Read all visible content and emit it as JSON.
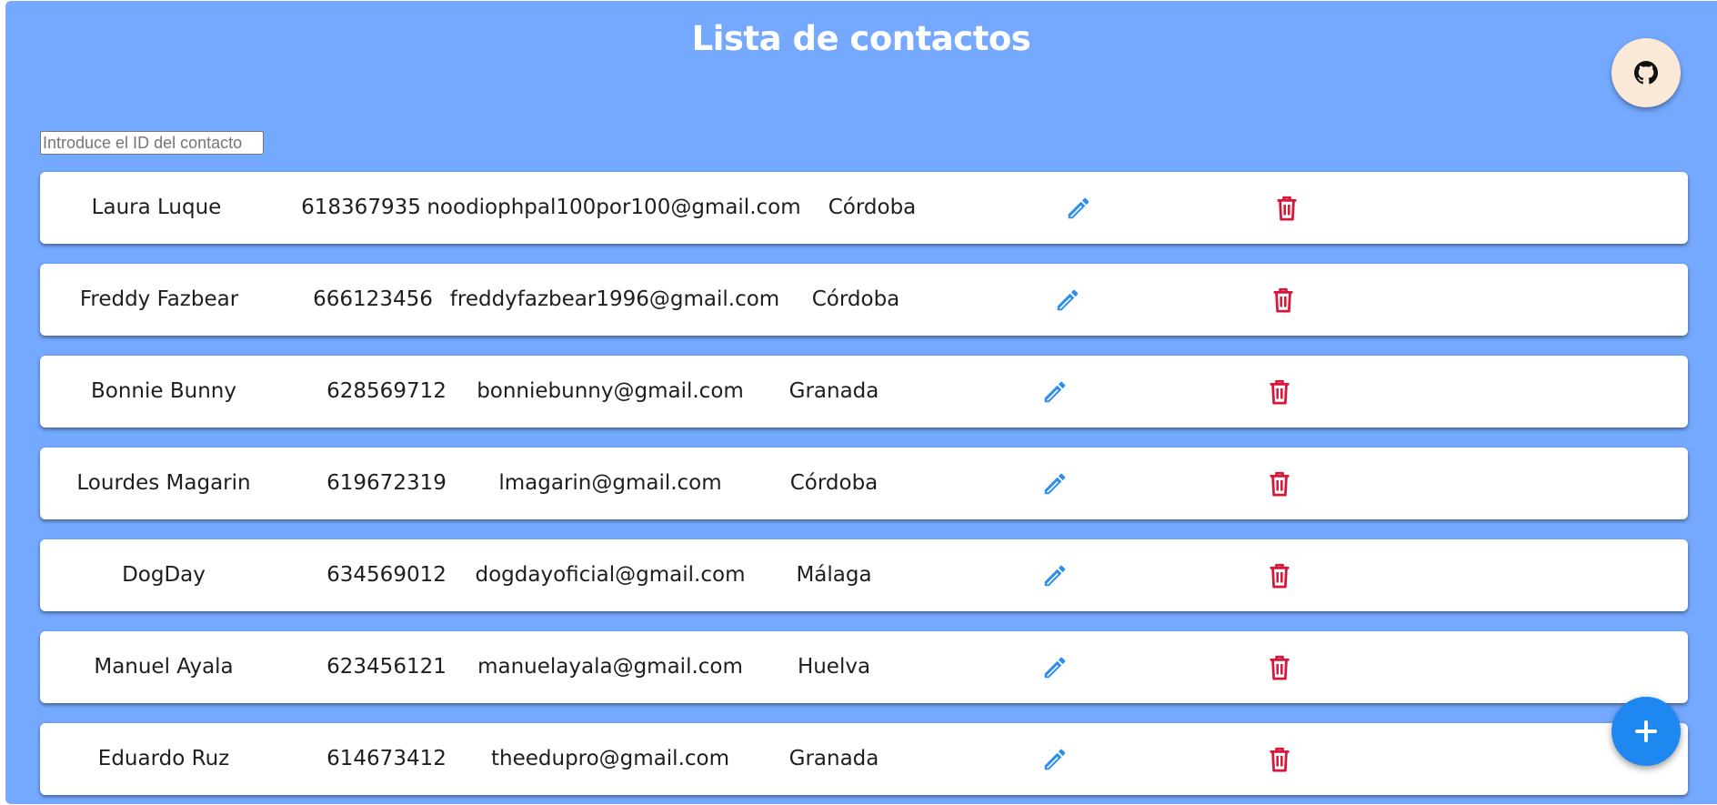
{
  "header": {
    "title": "Lista de contactos",
    "github_icon": "github-icon"
  },
  "search": {
    "placeholder": "Introduce el ID del contacto",
    "value": ""
  },
  "contacts": [
    {
      "name": "Laura Luque",
      "phone": "618367935",
      "email": "noodiophpal100por100@gmail.com",
      "city": "Córdoba"
    },
    {
      "name": "Freddy Fazbear",
      "phone": "666123456",
      "email": "freddyfazbear1996@gmail.com",
      "city": "Córdoba"
    },
    {
      "name": "Bonnie Bunny",
      "phone": "628569712",
      "email": "bonniebunny@gmail.com",
      "city": "Granada"
    },
    {
      "name": "Lourdes Magarin",
      "phone": "619672319",
      "email": "lmagarin@gmail.com",
      "city": "Córdoba"
    },
    {
      "name": "DogDay",
      "phone": "634569012",
      "email": "dogdayoficial@gmail.com",
      "city": "Málaga"
    },
    {
      "name": "Manuel Ayala",
      "phone": "623456121",
      "email": "manuelayala@gmail.com",
      "city": "Huelva"
    },
    {
      "name": "Eduardo Ruz",
      "phone": "614673412",
      "email": "theedupro@gmail.com",
      "city": "Granada"
    }
  ],
  "icons": {
    "edit": "pencil-icon",
    "delete": "trash-icon",
    "add": "plus-icon"
  },
  "colors": {
    "background": "#75a9ff",
    "edit_icon": "#2b8ef0",
    "delete_icon": "#d9163a",
    "add_button": "#1e88f0",
    "github_button": "#fbe9d8"
  }
}
